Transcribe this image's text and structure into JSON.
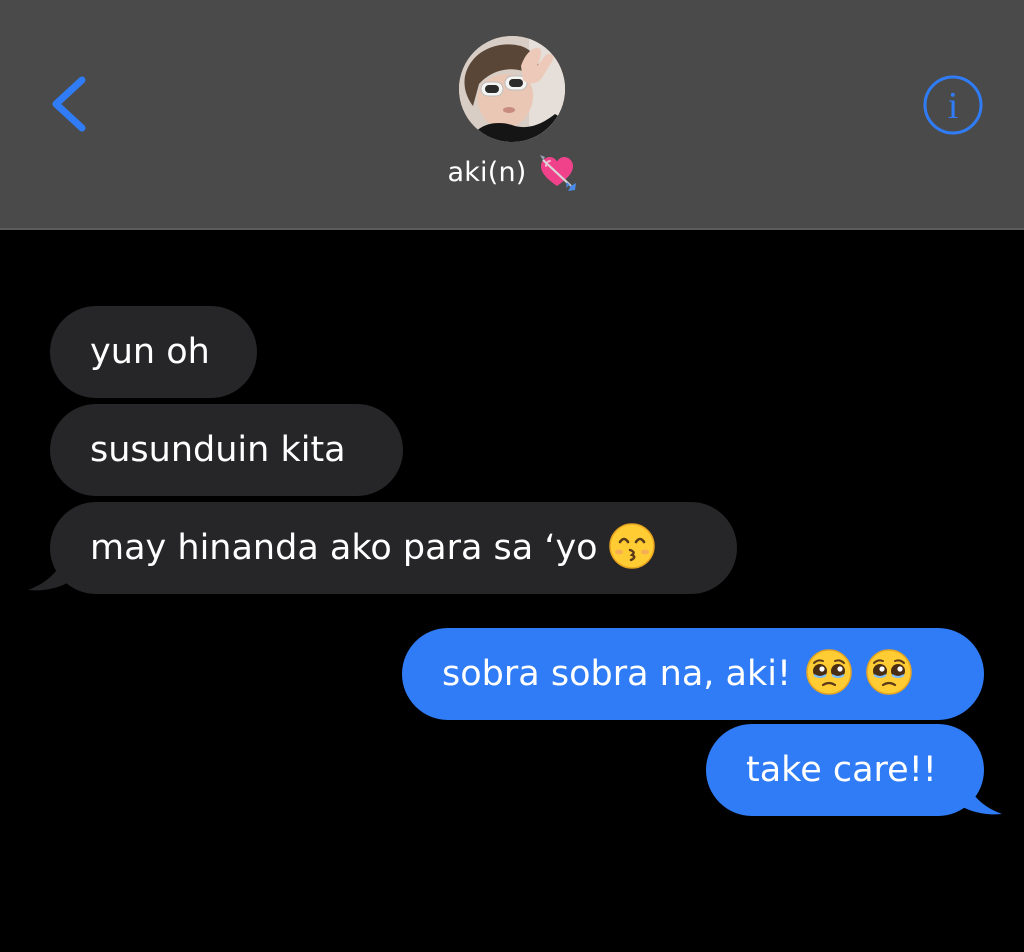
{
  "header": {
    "contact_name": "aki(n)",
    "contact_emoji": "heart-with-arrow-icon",
    "back_icon": "chevron-left-icon",
    "info_icon": "info-icon",
    "info_glyph": "i",
    "accent_color": "#2f7cf6",
    "background_color": "#4a4a4a"
  },
  "messages": [
    {
      "direction": "received",
      "text": "yun oh"
    },
    {
      "direction": "received",
      "text": "susunduin kita"
    },
    {
      "direction": "received",
      "text": "may hinanda ako para sa ‘yo",
      "emoji": [
        "kissing-smiling-eyes-emoji"
      ]
    },
    {
      "direction": "sent",
      "text": "sobra sobra na, aki!",
      "emoji": [
        "pleading-face-emoji",
        "pleading-face-emoji"
      ]
    },
    {
      "direction": "sent",
      "text": "take care!!"
    }
  ],
  "colors": {
    "received_bubble": "#262628",
    "sent_bubble": "#2f7cf6",
    "thread_background": "#000000"
  }
}
